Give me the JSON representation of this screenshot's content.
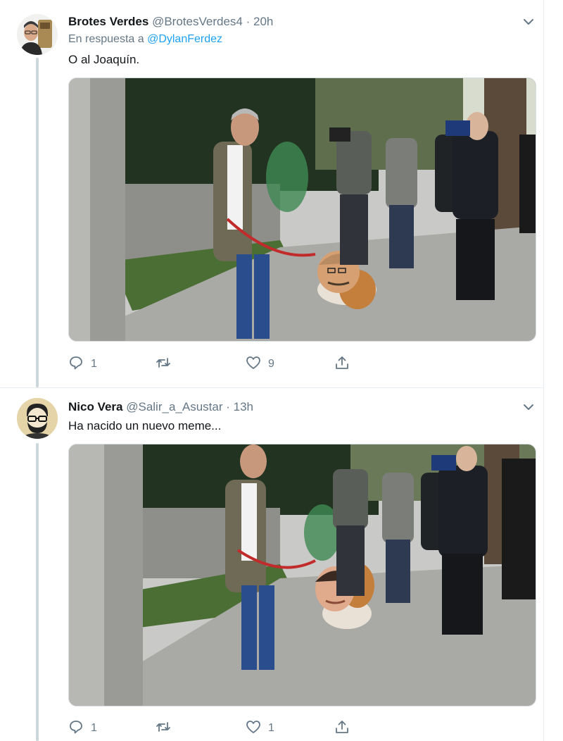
{
  "tweets": [
    {
      "name": "Brotes Verdes",
      "handle": "@BrotesVerdes4",
      "time": "20h",
      "reply_prefix": "En respuesta a",
      "reply_to": "@DylanFerdez",
      "text": "O al Joaquín.",
      "replies": "1",
      "retweets": "",
      "likes": "9"
    },
    {
      "name": "Nico Vera",
      "handle": "@Salir_a_Asustar",
      "time": "13h",
      "text": "Ha nacido un nuevo meme...",
      "replies": "1",
      "retweets": "",
      "likes": "1"
    }
  ],
  "separator": "·",
  "icons": [
    "chevron-down-icon",
    "reply-icon",
    "retweet-icon",
    "like-icon",
    "share-icon"
  ],
  "colors": {
    "link": "#1da1f2",
    "muted": "#657786",
    "border": "#e6ecf0"
  }
}
